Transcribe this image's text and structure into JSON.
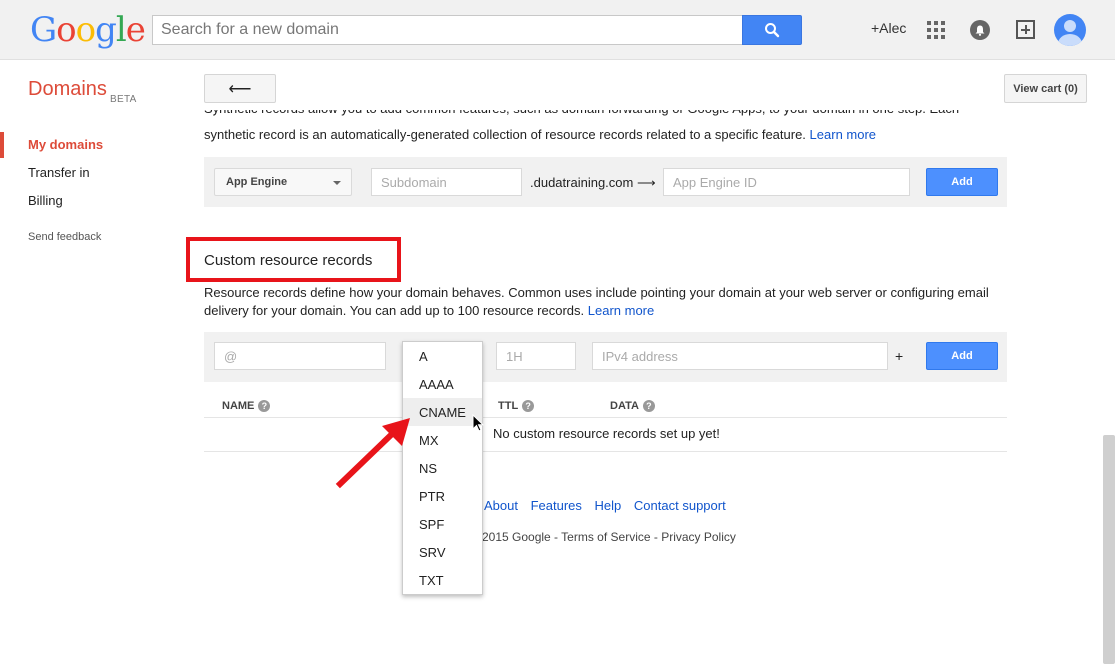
{
  "header": {
    "logo_letters": [
      {
        "char": "G",
        "color": "#4285f4"
      },
      {
        "char": "o",
        "color": "#ea4335"
      },
      {
        "char": "o",
        "color": "#fbbc05"
      },
      {
        "char": "g",
        "color": "#4285f4"
      },
      {
        "char": "l",
        "color": "#34a853"
      },
      {
        "char": "e",
        "color": "#ea4335"
      }
    ],
    "search_placeholder": "Search for a new domain",
    "user_label": "+Alec"
  },
  "sidebar": {
    "product_name": "Domains",
    "product_tag": "BETA",
    "items": [
      {
        "label": "My domains",
        "active": true
      },
      {
        "label": "Transfer in",
        "active": false
      },
      {
        "label": "Billing",
        "active": false
      }
    ],
    "feedback_label": "Send feedback"
  },
  "toolbar": {
    "back_label": "⟵",
    "cart_label": "View cart (0)"
  },
  "synthetic": {
    "cut_line": "Synthetic records allow you to add common features, such as domain forwarding or Google Apps, to your domain in one step. Each",
    "desc": "synthetic record is an automatically-generated collection of resource records related to a specific feature.",
    "learn_more": "Learn more",
    "type_value": "App Engine",
    "subdomain_placeholder": "Subdomain",
    "domain_suffix": ".dudatraining.com ⟶",
    "id_placeholder": "App Engine ID",
    "add_label": "Add"
  },
  "custom": {
    "title": "Custom resource records",
    "desc": "Resource records define how your domain behaves. Common uses include pointing your domain at your web server or configuring email delivery for your domain. You can add up to 100 resource records.",
    "learn_more": "Learn more",
    "name_placeholder": "@",
    "ttl_placeholder": "1H",
    "data_placeholder": "IPv4 address",
    "plus_label": "+",
    "add_label": "Add",
    "columns": [
      "NAME",
      "TTL",
      "DATA"
    ],
    "empty_message": "No custom resource records set up yet!",
    "type_options": [
      "A",
      "AAAA",
      "CNAME",
      "MX",
      "NS",
      "PTR",
      "SPF",
      "SRV",
      "TXT"
    ],
    "hovered_option": "CNAME"
  },
  "footer": {
    "links": [
      "About",
      "Features",
      "Help",
      "Contact support"
    ],
    "copyright": "2015 Google - Terms of Service - Privacy Policy"
  },
  "colors": {
    "accent_red": "#dd4b39",
    "link_blue": "#1155cc",
    "button_blue": "#4d90fe",
    "annotation_red": "#e8141a"
  }
}
